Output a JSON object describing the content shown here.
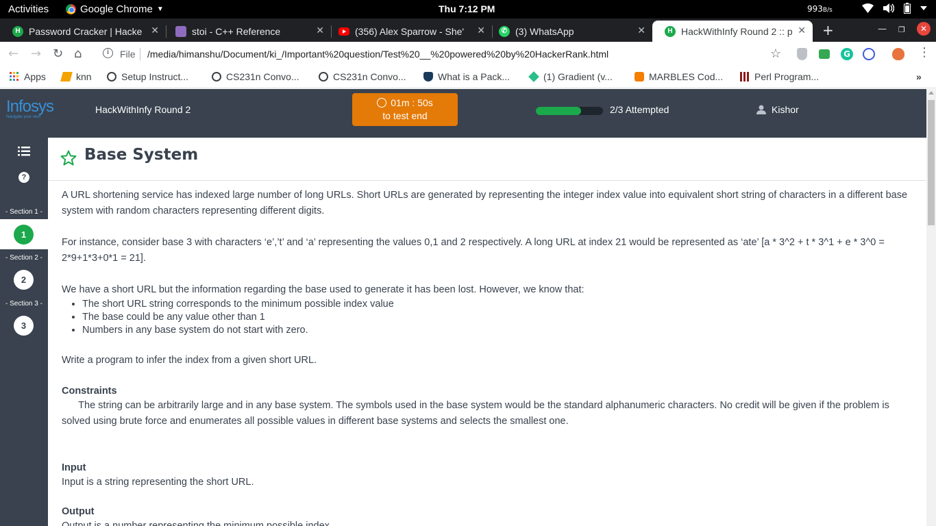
{
  "os": {
    "activities": "Activities",
    "app_name": "Google Chrome",
    "clock": "Thu  7:12 PM",
    "net_speed": "993",
    "net_unit": "B/s"
  },
  "tabs": [
    {
      "title": "Password Cracker | Hacke",
      "favicon_color": "#1ba94c",
      "favicon_letter": "H"
    },
    {
      "title": "stoi - C++ Reference",
      "favicon_color": "#8e6bbf",
      "favicon_letter": ""
    },
    {
      "title": "(356) Alex Sparrow - She'",
      "favicon_color": "#ff0000",
      "favicon_letter": ""
    },
    {
      "title": "(3) WhatsApp",
      "favicon_color": "#25d366",
      "favicon_letter": ""
    },
    {
      "title": "HackWithInfy Round 2 :: p",
      "favicon_color": "#1ba94c",
      "favicon_letter": "H",
      "active": true
    }
  ],
  "address": {
    "scheme_label": "File",
    "url": "/media/himanshu/Document/ki_/Important%20question/Test%20__%20powered%20by%20HackerRank.html"
  },
  "bookmarks": [
    {
      "label": "Apps"
    },
    {
      "label": "knn"
    },
    {
      "label": "Setup Instruct..."
    },
    {
      "label": "CS231n Convo..."
    },
    {
      "label": "CS231n Convo..."
    },
    {
      "label": "What is a Pack..."
    },
    {
      "label": "(1) Gradient (v..."
    },
    {
      "label": "MARBLES Cod..."
    },
    {
      "label": "Perl Program..."
    }
  ],
  "header": {
    "logo_text": "Infosys",
    "logo_tagline": "Navigate your next",
    "test_title": "HackWithInfy Round 2",
    "timer_value": "01m : 50s",
    "timer_caption": "to test end",
    "progress_fraction": 0.67,
    "attempted": "2/3 Attempted",
    "user": "Kishor"
  },
  "sidebar": {
    "sections": [
      {
        "label": "- Section 1 -",
        "number": "1",
        "active": true
      },
      {
        "label": "- Section 2 -",
        "number": "2"
      },
      {
        "label": "- Section 3 -",
        "number": "3"
      }
    ]
  },
  "question": {
    "title": "Base System",
    "p1": "A URL shortening service has indexed large number of long URLs. Short URLs are generated by representing the integer index value into equivalent short string of characters in a different base system with random characters representing different digits.",
    "p2": "For instance, consider base 3 with characters ‘e’,’t’ and ‘a’ representing the values 0,1 and 2 respectively.  A long URL at index 21 would be represented as ‘ate’ [a * 3^2 + t * 3^1 + e * 3^0 = 2*9+1*3+0*1 = 21].",
    "p3": "We have a short URL but the information regarding the base used to generate it has been lost. However, we know that:",
    "bullets": [
      "The short URL string corresponds to the minimum possible index value",
      "The base could be any value other than 1",
      "Numbers in any base system do not start with zero."
    ],
    "p4": "Write a program to infer the index from a given short URL.",
    "constraints_heading": "Constraints",
    "constraints_text": "      The string can be arbitrarily large and in any base system. The symbols used in the base system would be the standard alphanumeric characters. No credit will be given if the problem is solved using brute force and enumerates all possible values in different base systems and selects the smallest one.",
    "input_heading": "Input",
    "input_text": "Input is a string representing the short URL.",
    "output_heading": "Output",
    "output_text": "Output is a number representing the minimum possible index."
  }
}
